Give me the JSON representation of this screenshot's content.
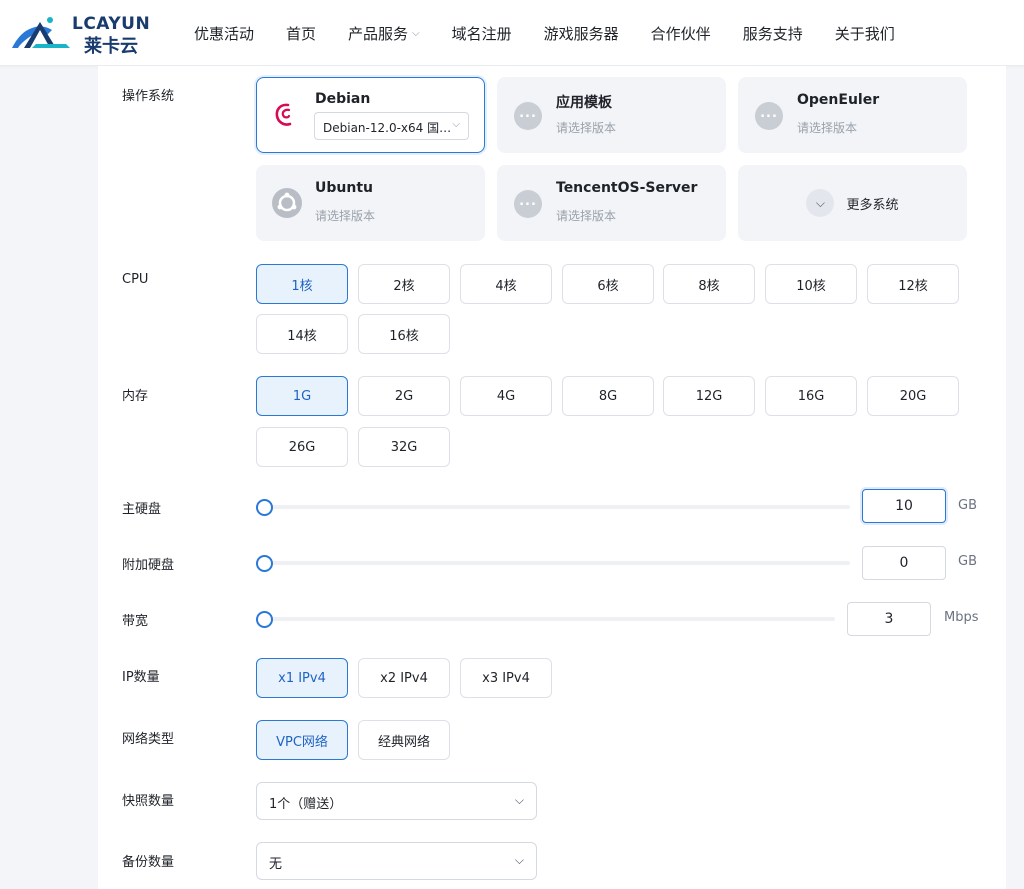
{
  "brand": {
    "name_top": "LCAYUN",
    "name_bottom": "莱卡云"
  },
  "nav": {
    "items": [
      {
        "label": "优惠活动",
        "dropdown": false
      },
      {
        "label": "首页",
        "dropdown": false
      },
      {
        "label": "产品服务",
        "dropdown": true
      },
      {
        "label": "域名注册",
        "dropdown": false
      },
      {
        "label": "游戏服务器",
        "dropdown": false
      },
      {
        "label": "合作伙伴",
        "dropdown": false
      },
      {
        "label": "服务支持",
        "dropdown": false
      },
      {
        "label": "关于我们",
        "dropdown": false
      }
    ]
  },
  "labels": {
    "os": "操作系统",
    "cpu": "CPU",
    "memory": "内存",
    "main_disk": "主硬盘",
    "extra_disk": "附加硬盘",
    "bandwidth": "带宽",
    "ip_count": "IP数量",
    "network_type": "网络类型",
    "snapshot_count": "快照数量",
    "backup_count": "备份数量"
  },
  "os": {
    "selected": {
      "name": "Debian",
      "version": "Debian-12.0-x64 国…"
    },
    "cards": [
      {
        "name": "应用模板",
        "sub": "请选择版本"
      },
      {
        "name": "OpenEuler",
        "sub": "请选择版本"
      },
      {
        "name": "Ubuntu",
        "sub": "请选择版本"
      },
      {
        "name": "TencentOS-Server",
        "sub": "请选择版本"
      }
    ],
    "more": "更多系统"
  },
  "cpu": {
    "options": [
      "1核",
      "2核",
      "4核",
      "6核",
      "8核",
      "10核",
      "12核",
      "14核",
      "16核"
    ],
    "selected": "1核"
  },
  "memory": {
    "options": [
      "1G",
      "2G",
      "4G",
      "8G",
      "12G",
      "16G",
      "20G",
      "26G",
      "32G"
    ],
    "selected": "1G"
  },
  "main_disk": {
    "value": "10",
    "unit": "GB",
    "slider_level": 0
  },
  "extra_disk": {
    "value": "0",
    "unit": "GB",
    "slider_level": 0
  },
  "bandwidth": {
    "value": "3",
    "unit": "Mbps",
    "slider_level": 0
  },
  "ip_count": {
    "options": [
      "x1 IPv4",
      "x2 IPv4",
      "x3 IPv4"
    ],
    "selected": "x1 IPv4"
  },
  "network_type": {
    "options": [
      "VPC网络",
      "经典网络"
    ],
    "selected": "VPC网络"
  },
  "snapshot": {
    "value": "1个（赠送）"
  },
  "backup": {
    "value": "无"
  },
  "colors": {
    "accent": "#2a79d6",
    "active_bg": "#e8f2fd",
    "debian_red": "#d70a53"
  }
}
